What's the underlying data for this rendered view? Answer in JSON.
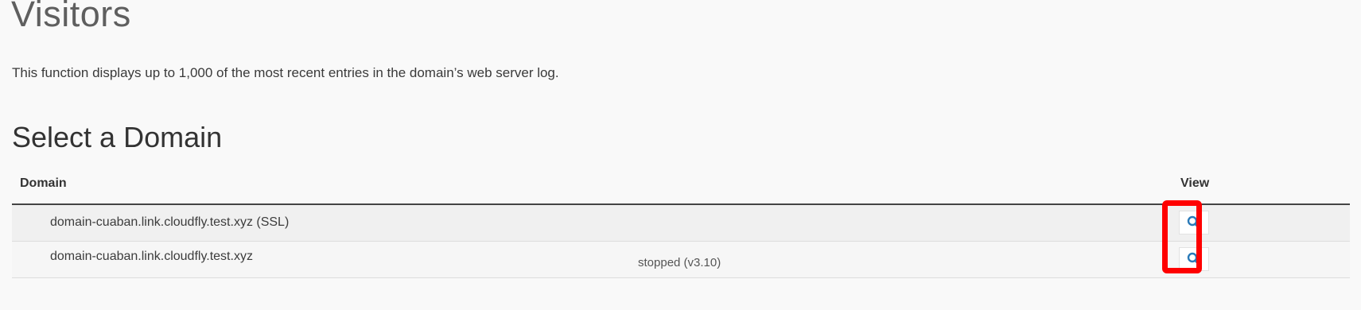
{
  "page": {
    "title": "Visitors",
    "description": "This function displays up to 1,000 of the most recent entries in the domain’s web server log."
  },
  "domain_table": {
    "heading": "Select a Domain",
    "columns": {
      "domain": "Domain",
      "view": "View"
    },
    "rows": [
      {
        "domain": "domain-cuaban.link.cloudfly.test.xyz (SSL)",
        "status": "",
        "view_icon": "search-icon"
      },
      {
        "domain": "domain-cuaban.link.cloudfly.test.xyz",
        "status": "stopped (v3.10)",
        "view_icon": "search-icon"
      }
    ]
  },
  "colors": {
    "background": "#f9f9f9",
    "icon_blue": "#2a7ab8",
    "highlight_red": "#ff0000",
    "header_border": "#444444"
  }
}
